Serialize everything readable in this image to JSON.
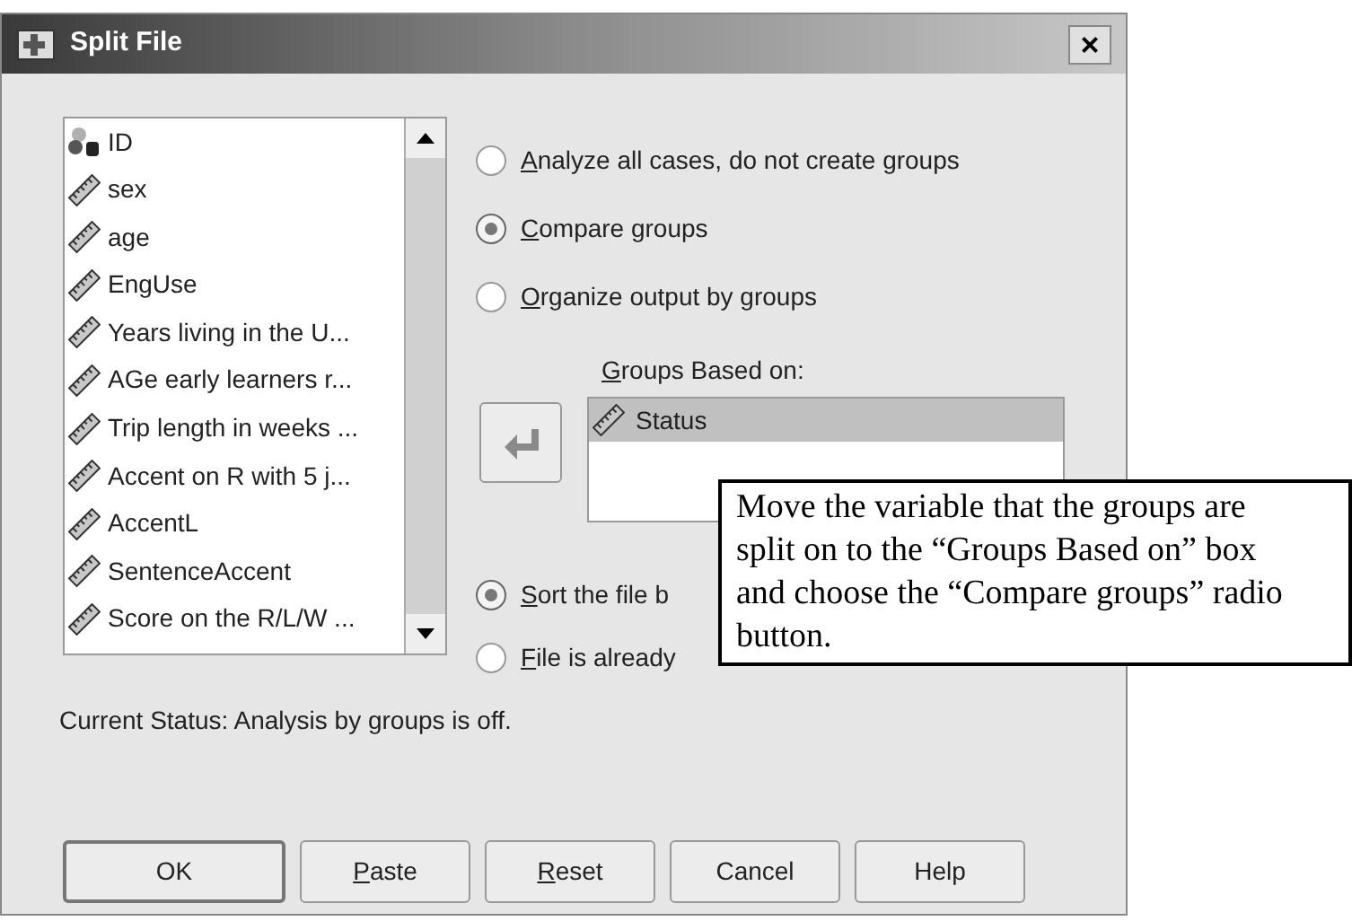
{
  "window": {
    "title": "Split File",
    "close": "×"
  },
  "variables": [
    {
      "kind": "string",
      "name": "ID"
    },
    {
      "kind": "scale",
      "name": "sex"
    },
    {
      "kind": "scale",
      "name": "age"
    },
    {
      "kind": "scale",
      "name": "EngUse"
    },
    {
      "kind": "scale",
      "name": "Years living in the U..."
    },
    {
      "kind": "scale",
      "name": "AGe early learners r..."
    },
    {
      "kind": "scale",
      "name": "Trip length in weeks ..."
    },
    {
      "kind": "scale",
      "name": "Accent on R with 5 j..."
    },
    {
      "kind": "scale",
      "name": "AccentL"
    },
    {
      "kind": "scale",
      "name": "SentenceAccent"
    },
    {
      "kind": "scale",
      "name": "Score on the R/L/W ..."
    }
  ],
  "mode_options": [
    {
      "key": "A",
      "rest": "nalyze all cases, do not create groups",
      "selected": false
    },
    {
      "key": "C",
      "rest": "ompare groups",
      "selected": true
    },
    {
      "key": "O",
      "rest": "rganize output by groups",
      "selected": false
    }
  ],
  "groups_based_on": {
    "key": "G",
    "rest": "roups Based on:",
    "items": [
      {
        "kind": "scale",
        "name": "Status",
        "selected": true
      }
    ]
  },
  "sort_options": [
    {
      "key": "S",
      "rest": "ort the file b",
      "selected": true
    },
    {
      "key": "F",
      "rest": "ile is already",
      "selected": false
    }
  ],
  "status": "Current Status: Analysis by groups is off.",
  "buttons": [
    {
      "rest": "OK",
      "default": true
    },
    {
      "key": "P",
      "rest": "aste",
      "default": false
    },
    {
      "key": "R",
      "rest": "eset",
      "default": false
    },
    {
      "rest": "Cancel",
      "default": false
    },
    {
      "rest": "Help",
      "default": false
    }
  ],
  "callout": "Move the variable that the groups are split on to the “Groups Based on” box and choose the “Compare groups” radio button."
}
